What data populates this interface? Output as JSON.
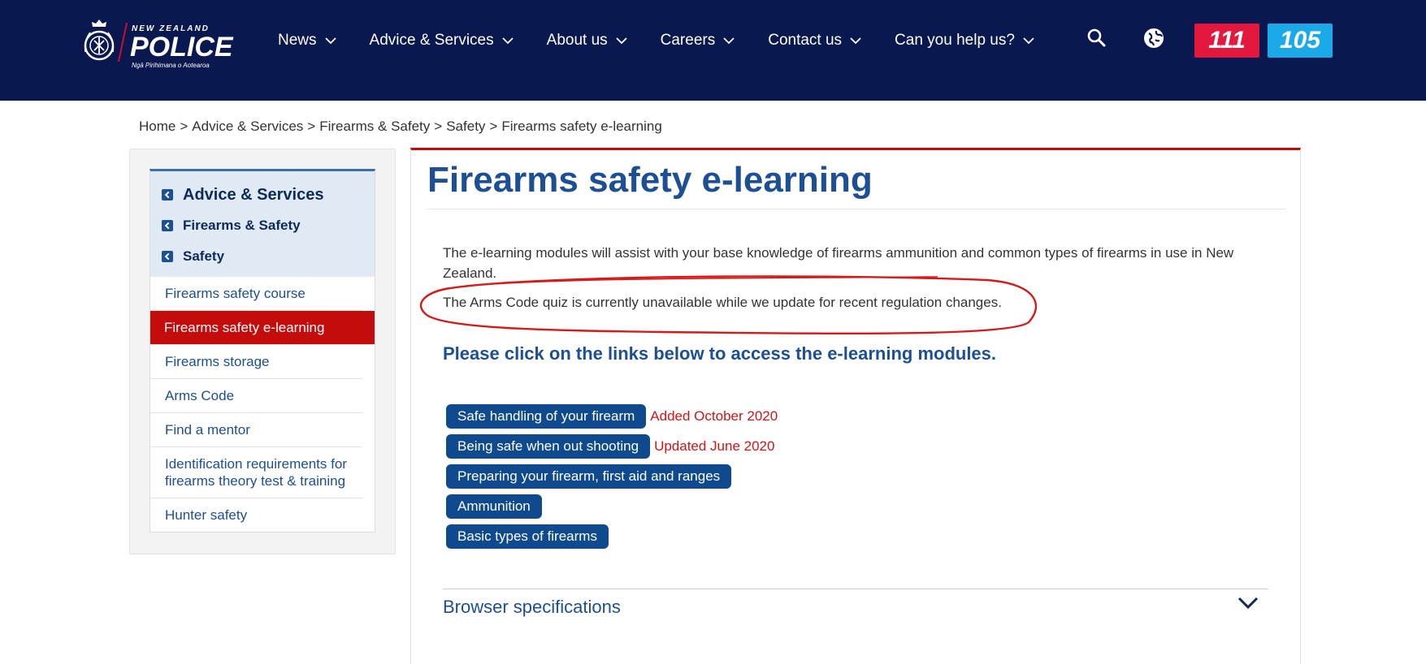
{
  "header": {
    "logo": {
      "top_line": "NEW ZEALAND",
      "name": "POLICE",
      "tagline": "Ngā Pirihimana o Aotearoa"
    },
    "nav": [
      {
        "label": "News"
      },
      {
        "label": "Advice & Services"
      },
      {
        "label": "About us"
      },
      {
        "label": "Careers"
      },
      {
        "label": "Contact us"
      },
      {
        "label": "Can you help us?"
      }
    ],
    "search_icon": "search-icon",
    "globe_icon": "globe-icon",
    "emergency_label": "111",
    "non_emergency_label": "105",
    "colors": {
      "header_bg": "#0a1850",
      "btn_111": "#e4173e",
      "btn_105": "#1aaae8"
    }
  },
  "breadcrumb": {
    "items": [
      "Home",
      "Advice & Services",
      "Firearms & Safety",
      "Safety",
      "Firearms safety e-learning"
    ],
    "separator": ">"
  },
  "sidebar": {
    "parents": [
      {
        "label": "Advice & Services"
      },
      {
        "label": "Firearms & Safety"
      },
      {
        "label": "Safety"
      }
    ],
    "items": [
      {
        "label": "Firearms safety course"
      },
      {
        "label": "Firearms safety e-learning"
      },
      {
        "label": "Firearms storage"
      },
      {
        "label": "Arms Code"
      },
      {
        "label": "Find a mentor"
      },
      {
        "label": "Identification requirements for firearms theory test & training"
      },
      {
        "label": "Hunter safety"
      }
    ],
    "active_color": "#c40c0c"
  },
  "main": {
    "title": "Firearms safety e-learning",
    "intro": "The e-learning modules will assist with your base knowledge of firearms ammunition and common types of firearms in use in New Zealand.",
    "notice": "The Arms Code quiz is currently unavailable while we update for recent regulation changes.",
    "lead": "Please click on the links below to access the e-learning modules.",
    "modules": [
      {
        "label": "Safe handling of your firearm",
        "note": "Added October 2020"
      },
      {
        "label": "Being safe when out shooting",
        "note": "Updated June 2020"
      },
      {
        "label": "Preparing your firearm, first aid and ranges",
        "note": ""
      },
      {
        "label": "Ammunition",
        "note": ""
      },
      {
        "label": "Basic types of firearms",
        "note": ""
      }
    ],
    "accordion_label": "Browser specifications",
    "accordion_icon": "chevron-down-icon"
  }
}
